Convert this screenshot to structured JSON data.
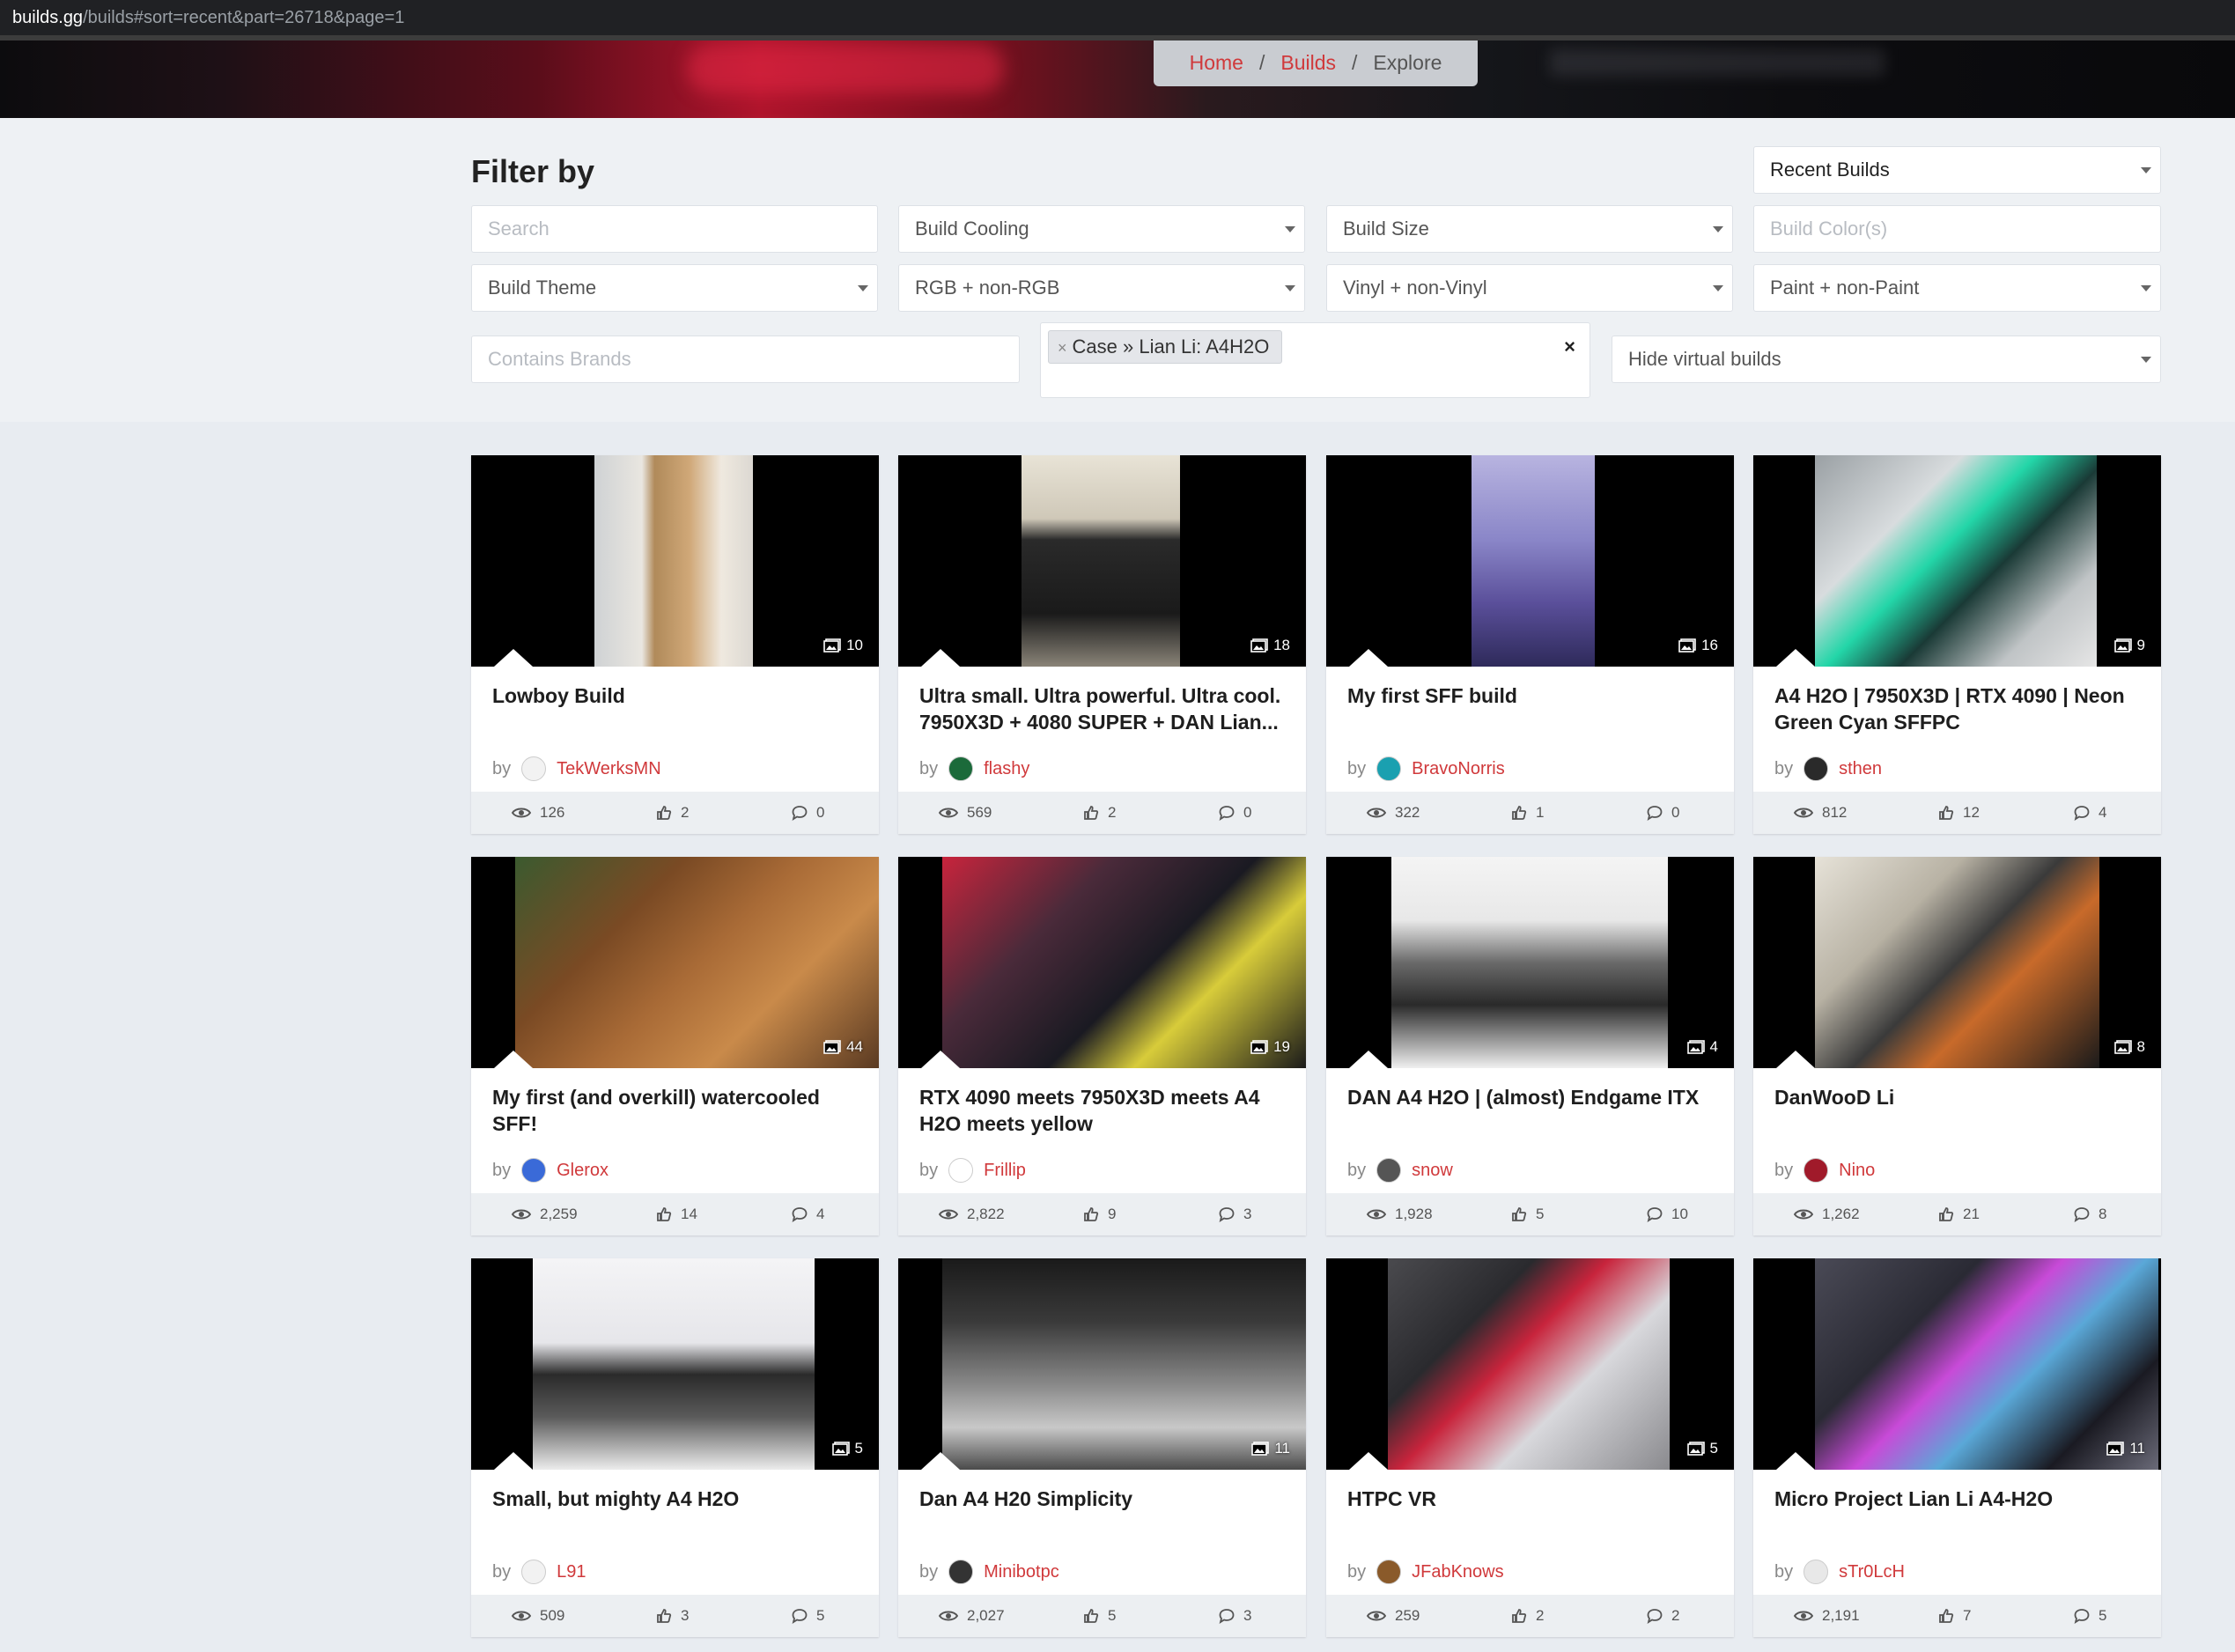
{
  "browser": {
    "url_host": "builds.gg",
    "url_rest": "/builds#sort=recent&part=26718&page=1"
  },
  "breadcrumb": {
    "home": "Home",
    "builds": "Builds",
    "explore": "Explore",
    "sep": "/"
  },
  "filters": {
    "title": "Filter by",
    "sort": "Recent Builds",
    "search_placeholder": "Search",
    "cooling": "Build Cooling",
    "size": "Build Size",
    "color_placeholder": "Build Color(s)",
    "theme": "Build Theme",
    "rgb": "RGB + non-RGB",
    "vinyl": "Vinyl + non-Vinyl",
    "paint": "Paint + non-Paint",
    "brands_placeholder": "Contains Brands",
    "part_tag": "Case » Lian Li: A4H2O",
    "tag_remove": "×",
    "clear": "×",
    "virtual": "Hide virtual builds"
  },
  "cards": [
    {
      "title": "Lowboy Build",
      "by": "by",
      "user": "TekWerksMN",
      "photos": "10",
      "views": "126",
      "likes": "2",
      "comments": "0"
    },
    {
      "title": "Ultra small. Ultra powerful. Ultra cool. 7950X3D + 4080 SUPER + DAN Lian...",
      "by": "by",
      "user": "flashy",
      "photos": "18",
      "views": "569",
      "likes": "2",
      "comments": "0"
    },
    {
      "title": "My first SFF build",
      "by": "by",
      "user": "BravoNorris",
      "photos": "16",
      "views": "322",
      "likes": "1",
      "comments": "0"
    },
    {
      "title": "A4 H2O | 7950X3D | RTX 4090 | Neon Green Cyan SFFPC",
      "by": "by",
      "user": "sthen",
      "photos": "9",
      "views": "812",
      "likes": "12",
      "comments": "4"
    },
    {
      "title": "My first (and overkill) watercooled SFF!",
      "by": "by",
      "user": "Glerox",
      "photos": "44",
      "views": "2,259",
      "likes": "14",
      "comments": "4"
    },
    {
      "title": "RTX 4090 meets 7950X3D meets A4 H2O meets yellow",
      "by": "by",
      "user": "Frillip",
      "photos": "19",
      "views": "2,822",
      "likes": "9",
      "comments": "3"
    },
    {
      "title": "DAN A4 H2O | (almost) Endgame ITX",
      "by": "by",
      "user": "snow",
      "photos": "4",
      "views": "1,928",
      "likes": "5",
      "comments": "10"
    },
    {
      "title": "DanWooD Li",
      "by": "by",
      "user": "Nino",
      "photos": "8",
      "views": "1,262",
      "likes": "21",
      "comments": "8"
    },
    {
      "title": "Small, but mighty A4 H2O",
      "by": "by",
      "user": "L91",
      "photos": "5",
      "views": "509",
      "likes": "3",
      "comments": "5"
    },
    {
      "title": "Dan A4 H20 Simplicity",
      "by": "by",
      "user": "Minibotpc",
      "photos": "11",
      "views": "2,027",
      "likes": "5",
      "comments": "3"
    },
    {
      "title": "HTPC VR",
      "by": "by",
      "user": "JFabKnows",
      "photos": "5",
      "views": "259",
      "likes": "2",
      "comments": "2"
    },
    {
      "title": "Micro Project Lian Li A4-H2O",
      "by": "by",
      "user": "sTr0LcH",
      "photos": "11",
      "views": "2,191",
      "likes": "7",
      "comments": "5"
    }
  ]
}
